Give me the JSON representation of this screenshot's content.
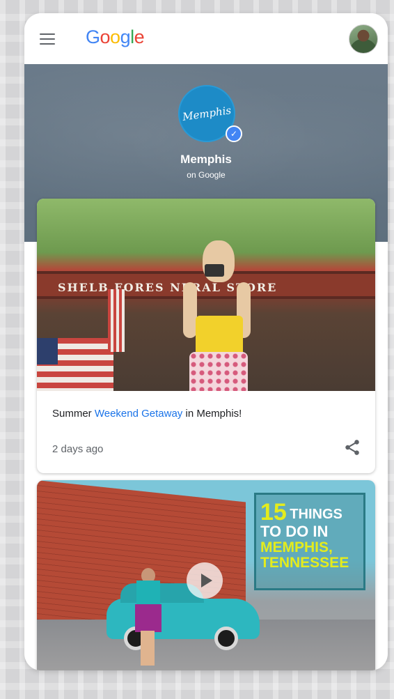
{
  "header": {
    "logo_letters": [
      {
        "ch": "G",
        "color": "#4285f4"
      },
      {
        "ch": "o",
        "color": "#ea4335"
      },
      {
        "ch": "o",
        "color": "#fbbc05"
      },
      {
        "ch": "g",
        "color": "#4285f4"
      },
      {
        "ch": "l",
        "color": "#34a853"
      },
      {
        "ch": "e",
        "color": "#ea4335"
      }
    ],
    "menu_icon": "hamburger-icon",
    "avatar": "user-avatar"
  },
  "profile": {
    "logo_script": "Memphis",
    "name": "Memphis",
    "subtitle": "on Google",
    "verified_icon": "check-icon"
  },
  "posts": [
    {
      "title_before": "Summer ",
      "title_link": "Weekend Getaway",
      "title_after": " in Memphis!",
      "time": "2 days ago",
      "share_icon": "share-icon",
      "image_sign": "SHELB  FORES    NERAL STORE"
    },
    {
      "promo_num": "15",
      "promo_line1": "THINGS",
      "promo_line2": "TO DO IN",
      "promo_line3": "MEMPHIS,",
      "promo_line4": "TENNESSEE",
      "play_icon": "play-icon"
    }
  ],
  "colors": {
    "link": "#1a73e8",
    "hero": "#6d7d8c",
    "brand": "#1d8bc7"
  }
}
